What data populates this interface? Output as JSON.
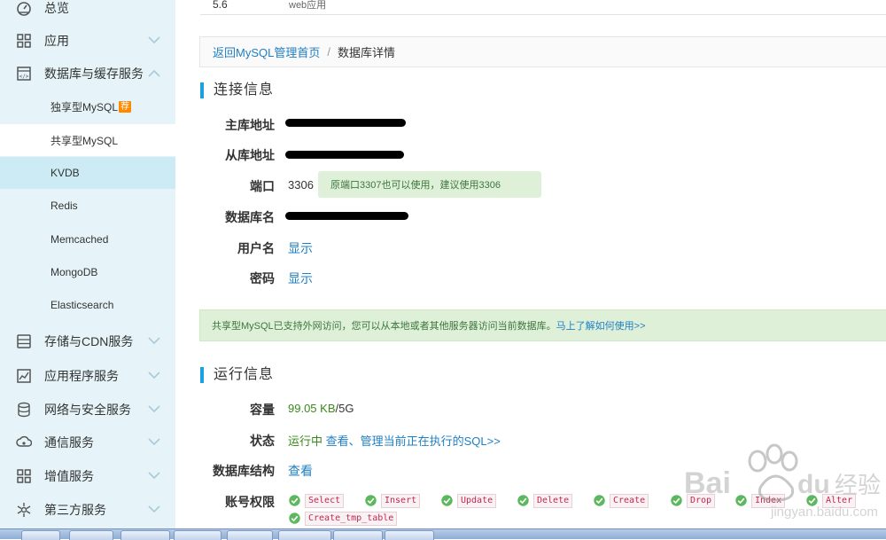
{
  "sidebar": {
    "groups_top": [
      {
        "label": "总览",
        "icon": "dashboard-icon"
      },
      {
        "label": "应用",
        "icon": "apps-grid-icon"
      },
      {
        "label": "数据库与缓存服务",
        "icon": "database-box-icon",
        "expanded": true
      }
    ],
    "sub_items": [
      {
        "label": "独享型MySQL",
        "badge": "荐"
      },
      {
        "label": "共享型MySQL",
        "state": "selected"
      },
      {
        "label": "KVDB",
        "state": "hover"
      },
      {
        "label": "Redis"
      },
      {
        "label": "Memcached"
      },
      {
        "label": "MongoDB"
      },
      {
        "label": "Elasticsearch"
      }
    ],
    "groups_bottom": [
      {
        "label": "存储与CDN服务",
        "icon": "storage-icon"
      },
      {
        "label": "应用程序服务",
        "icon": "app-service-icon"
      },
      {
        "label": "网络与安全服务",
        "icon": "network-security-icon"
      },
      {
        "label": "通信服务",
        "icon": "communication-icon"
      },
      {
        "label": "增值服务",
        "icon": "value-added-icon"
      },
      {
        "label": "第三方服务",
        "icon": "third-party-icon"
      }
    ]
  },
  "top_row": {
    "version": "5.6",
    "type": "web应用"
  },
  "breadcrumb": {
    "back_link": "返回MySQL管理首页",
    "separator": "/",
    "current": "数据库详情"
  },
  "connection": {
    "title": "连接信息",
    "master_label": "主库地址",
    "slave_label": "从库地址",
    "port_label": "端口",
    "port_value": "3306",
    "port_tip": "原端口3307也可以使用，建议使用3306",
    "dbname_label": "数据库名",
    "username_label": "用户名",
    "username_action": "显示",
    "password_label": "密码",
    "password_action": "显示"
  },
  "notice": {
    "text": "共享型MySQL已支持外网访问，您可以从本地或者其他服务器访问当前数据库。",
    "link": "马上了解如何使用>>"
  },
  "runtime": {
    "title": "运行信息",
    "capacity_label": "容量",
    "capacity_used": "99.05 KB",
    "capacity_total": "/5G",
    "status_label": "状态",
    "status_value": "运行中",
    "status_link": "查看、管理当前正在执行的SQL>>",
    "structure_label": "数据库结构",
    "structure_link": "查看",
    "permissions_label": "账号权限",
    "permissions": [
      "Select",
      "Insert",
      "Update",
      "Delete",
      "Create",
      "Drop",
      "Index",
      "Alter",
      "Create_tmp_table"
    ]
  },
  "colors": {
    "sidebar_bg": "#e6f4f9",
    "accent": "#1aa1e0",
    "link": "#1f7fc4",
    "success_bg": "#dff0d8",
    "code_red": "#c7254e",
    "badge_orange": "#ff8a00"
  }
}
